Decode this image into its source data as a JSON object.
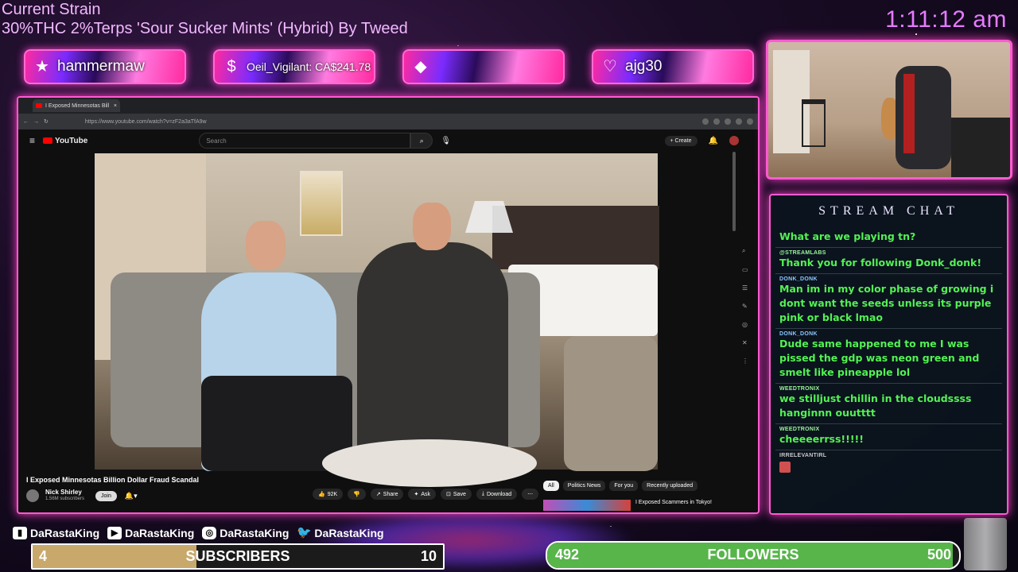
{
  "overlay": {
    "strain_title": "Current Strain",
    "strain_desc": "30%THC 2%Terps 'Sour Sucker Mints' (Hybrid) By  Tweed",
    "clock": "1:11:12 am",
    "alerts": [
      {
        "icon": "star-icon",
        "glyph": "★",
        "text": "hammermaw"
      },
      {
        "icon": "dollar-icon",
        "glyph": "$",
        "text": "Oeil_Vigilant: CA$241.78"
      },
      {
        "icon": "diamond-icon",
        "glyph": "◆",
        "text": ""
      },
      {
        "icon": "heart-icon",
        "glyph": "♡",
        "text": "ajg30"
      }
    ]
  },
  "browser": {
    "tab_title": "I Exposed Minnesotas Bill",
    "url": "https://www.youtube.com/watch?v=zF2a3aTfA9w",
    "youtube": {
      "logo": "YouTube",
      "search_placeholder": "Search",
      "create_label": "+ Create",
      "video_title": "I Exposed Minnesotas Billion Dollar Fraud Scandal",
      "channel_name": "Nick Shirley",
      "subscribers": "1.56M subscribers",
      "join_label": "Join",
      "likes": "92K",
      "share_label": "Share",
      "ask_label": "Ask",
      "save_label": "Save",
      "download_label": "Download",
      "chips": [
        "All",
        "Politics News",
        "For you",
        "Recently uploaded"
      ],
      "up_next_title": "I Exposed Scammers in Tokyo!"
    }
  },
  "chat": {
    "header": "STREAM CHAT",
    "messages": [
      {
        "user": "",
        "text": "What are we playing tn?"
      },
      {
        "user": "@STREAMLABS",
        "text": "Thank you for following Donk_donk!"
      },
      {
        "user": "DONK_DONK",
        "text": "Man im in my color phase of growing i dont want the seeds unless its purple pink or black lmao"
      },
      {
        "user": "DONK_DONK",
        "text": "Dude same happened to me I was pissed the gdp was neon green and smelt like pineapple lol"
      },
      {
        "user": "WEEDTRONIX",
        "text": "we stilljust chillin in the cloudssss hanginnn ouutttt"
      },
      {
        "user": "WEEDTRONIX",
        "text": "cheeeerrss!!!!!"
      },
      {
        "user": "IRRELEVANTIRL",
        "text": ""
      }
    ]
  },
  "socials": {
    "twitch": "DaRastaKing",
    "youtube": "DaRastaKing",
    "instagram": "DaRastaKing",
    "twitter": "DaRastaKing"
  },
  "goals": {
    "subscribers": {
      "label": "SUBSCRIBERS",
      "current": "4",
      "target": "10",
      "fraction": 0.4
    },
    "followers": {
      "label": "FOLLOWERS",
      "current": "492",
      "target": "500",
      "fraction": 0.984
    }
  },
  "colors": {
    "accent": "#ff5ad2",
    "chat_text": "#52f252",
    "clock": "#e77bff"
  }
}
